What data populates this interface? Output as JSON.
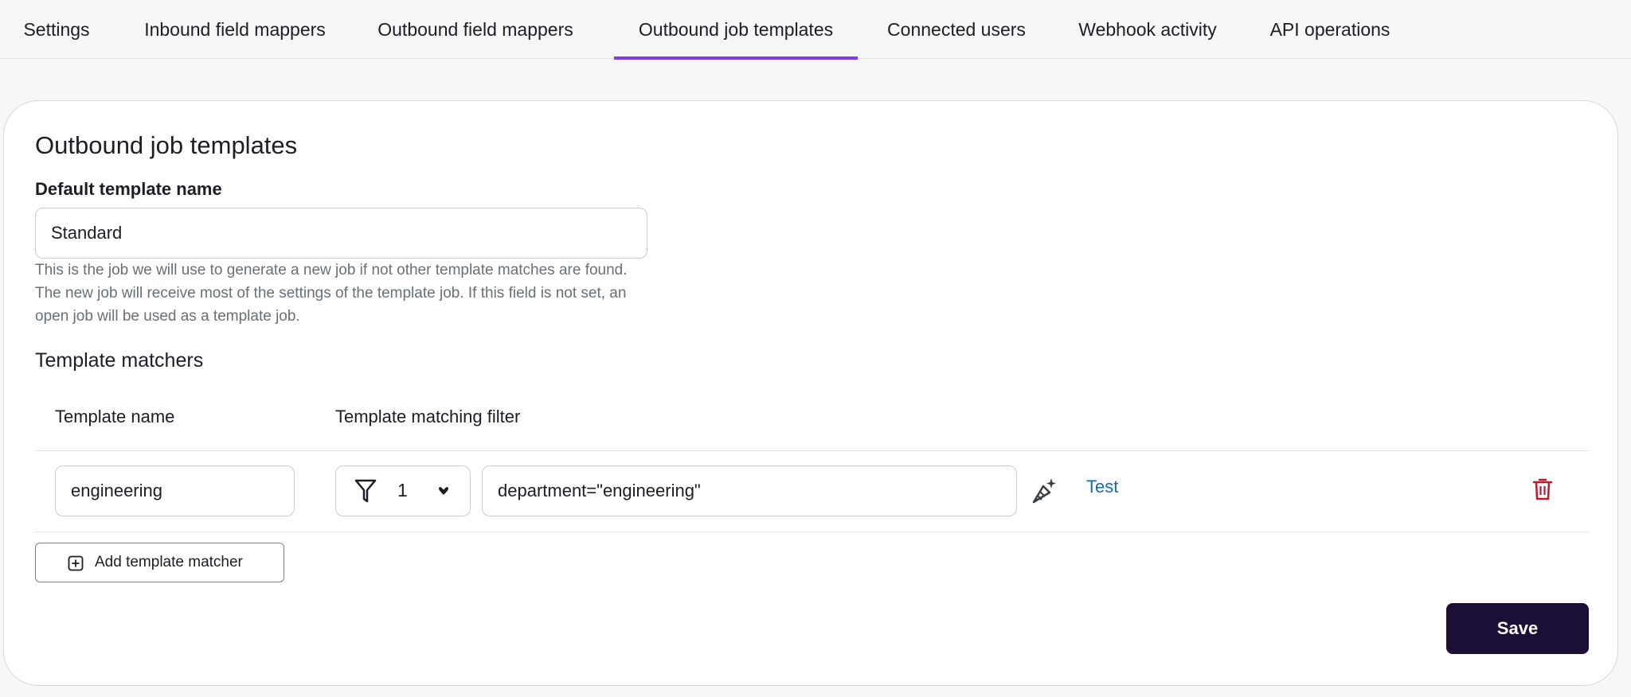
{
  "tabs": [
    {
      "label": "Settings"
    },
    {
      "label": "Inbound field mappers"
    },
    {
      "label": "Outbound field mappers"
    },
    {
      "label": "Outbound job templates",
      "active": true
    },
    {
      "label": "Connected users"
    },
    {
      "label": "Webhook activity"
    },
    {
      "label": "API operations"
    }
  ],
  "page": {
    "title": "Outbound job templates",
    "default_template": {
      "label": "Default template name",
      "value": "Standard",
      "help": "This is the job we will use to generate a new job if not other template matches are found. The new job will receive most of the settings of the template job. If this field is not set, an open job will be used as a template job."
    },
    "matchers": {
      "title": "Template matchers",
      "columns": {
        "name": "Template name",
        "filter": "Template matching filter"
      },
      "rows": [
        {
          "template_name": "engineering",
          "filter_count": "1",
          "filter_expression": "department=\"engineering\"",
          "test_label": "Test"
        }
      ],
      "add_label": "Add template matcher"
    },
    "save_label": "Save"
  },
  "colors": {
    "accent": "#7b3fe4",
    "save_button": "#1b0f35",
    "link": "#1a6aa6",
    "delete": "#c0182f"
  },
  "icons": [
    "filter-icon",
    "caret-down-icon",
    "magic-wand-icon",
    "trash-icon",
    "plus-square-icon"
  ]
}
